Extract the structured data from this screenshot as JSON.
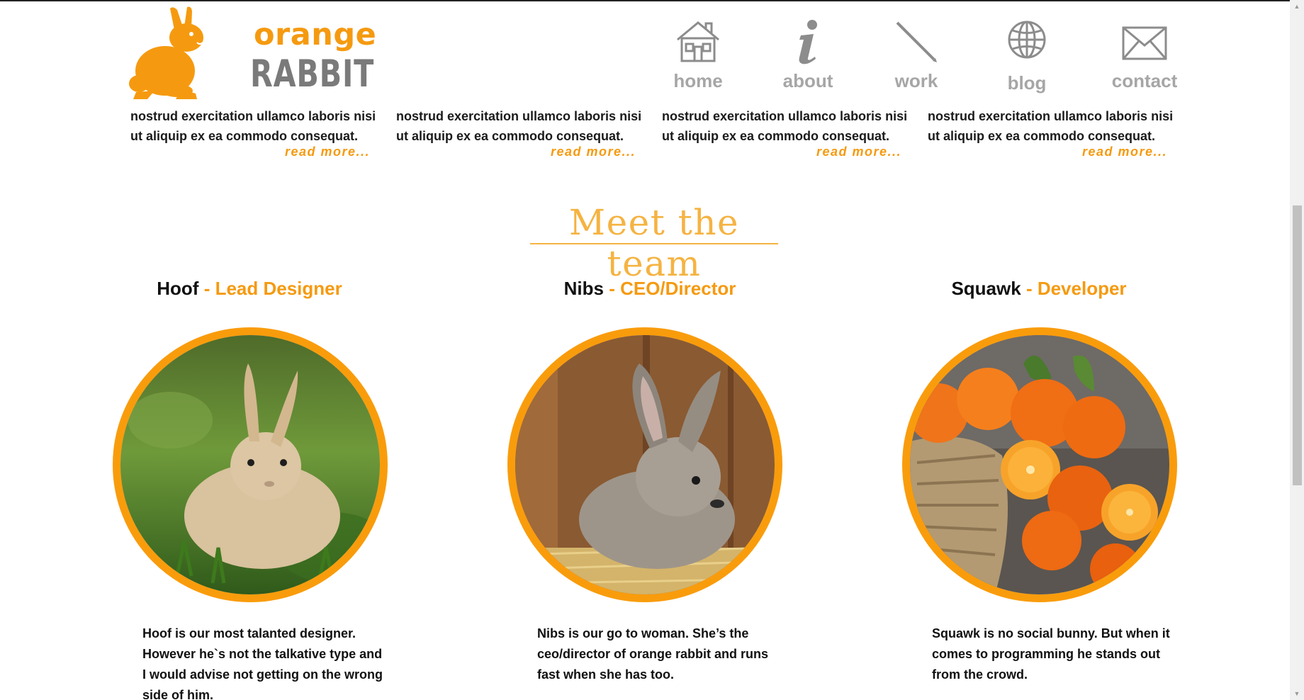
{
  "brand": {
    "logo_top": "orange",
    "logo_bottom": "RABBIT",
    "accent_color": "#f59a10",
    "logo_icon": "rabbit-silhouette-icon"
  },
  "nav": {
    "items": [
      {
        "label": "home",
        "icon": "house-icon"
      },
      {
        "label": "about",
        "icon": "info-icon"
      },
      {
        "label": "work",
        "icon": "pencil-icon"
      },
      {
        "label": "blog",
        "icon": "globe-icon"
      },
      {
        "label": "contact",
        "icon": "envelope-icon"
      }
    ]
  },
  "teasers": [
    {
      "text_cut": "nostrud exercitation ullamco laboris nisi",
      "text": "ut aliquip ex ea commodo consequat.",
      "more": "read more..."
    },
    {
      "text_cut": "nostrud exercitation ullamco laboris nisi",
      "text": "ut aliquip ex ea commodo consequat.",
      "more": "read more..."
    },
    {
      "text_cut": "nostrud exercitation ullamco laboris nisi",
      "text": "ut aliquip ex ea commodo consequat.",
      "more": "read more..."
    },
    {
      "text_cut": "nostrud exercitation ullamco laboris nisi",
      "text": "ut aliquip ex ea commodo consequat.",
      "more": "read more..."
    }
  ],
  "team": {
    "title": "Meet the team",
    "members": [
      {
        "name": "Hoof",
        "role": "- Lead Designer",
        "bio": "Hoof is our most talanted designer. However he`s not the talkative type and I would advise not getting on the wrong side of him.",
        "photo": "rabbit-in-grass"
      },
      {
        "name": "Nibs",
        "role": "- CEO/Director",
        "bio": "Nibs is our go to woman. She’s the ceo/director of orange rabbit and runs fast when she has too.",
        "photo": "rabbit-in-hutch"
      },
      {
        "name": "Squawk",
        "role": "- Developer",
        "bio": "Squawk is no social bunny. But when it comes to programming he stands out from the crowd.",
        "photo": "oranges-in-sack"
      }
    ]
  }
}
